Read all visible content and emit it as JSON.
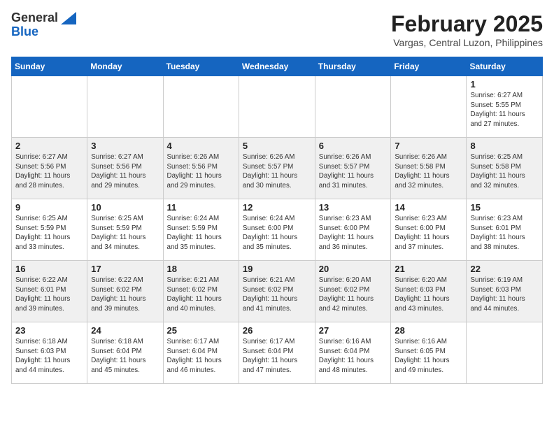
{
  "header": {
    "logo_general": "General",
    "logo_blue": "Blue",
    "month_year": "February 2025",
    "location": "Vargas, Central Luzon, Philippines"
  },
  "weekdays": [
    "Sunday",
    "Monday",
    "Tuesday",
    "Wednesday",
    "Thursday",
    "Friday",
    "Saturday"
  ],
  "weeks": [
    [
      {
        "day": "",
        "info": ""
      },
      {
        "day": "",
        "info": ""
      },
      {
        "day": "",
        "info": ""
      },
      {
        "day": "",
        "info": ""
      },
      {
        "day": "",
        "info": ""
      },
      {
        "day": "",
        "info": ""
      },
      {
        "day": "1",
        "info": "Sunrise: 6:27 AM\nSunset: 5:55 PM\nDaylight: 11 hours\nand 27 minutes."
      }
    ],
    [
      {
        "day": "2",
        "info": "Sunrise: 6:27 AM\nSunset: 5:56 PM\nDaylight: 11 hours\nand 28 minutes."
      },
      {
        "day": "3",
        "info": "Sunrise: 6:27 AM\nSunset: 5:56 PM\nDaylight: 11 hours\nand 29 minutes."
      },
      {
        "day": "4",
        "info": "Sunrise: 6:26 AM\nSunset: 5:56 PM\nDaylight: 11 hours\nand 29 minutes."
      },
      {
        "day": "5",
        "info": "Sunrise: 6:26 AM\nSunset: 5:57 PM\nDaylight: 11 hours\nand 30 minutes."
      },
      {
        "day": "6",
        "info": "Sunrise: 6:26 AM\nSunset: 5:57 PM\nDaylight: 11 hours\nand 31 minutes."
      },
      {
        "day": "7",
        "info": "Sunrise: 6:26 AM\nSunset: 5:58 PM\nDaylight: 11 hours\nand 32 minutes."
      },
      {
        "day": "8",
        "info": "Sunrise: 6:25 AM\nSunset: 5:58 PM\nDaylight: 11 hours\nand 32 minutes."
      }
    ],
    [
      {
        "day": "9",
        "info": "Sunrise: 6:25 AM\nSunset: 5:59 PM\nDaylight: 11 hours\nand 33 minutes."
      },
      {
        "day": "10",
        "info": "Sunrise: 6:25 AM\nSunset: 5:59 PM\nDaylight: 11 hours\nand 34 minutes."
      },
      {
        "day": "11",
        "info": "Sunrise: 6:24 AM\nSunset: 5:59 PM\nDaylight: 11 hours\nand 35 minutes."
      },
      {
        "day": "12",
        "info": "Sunrise: 6:24 AM\nSunset: 6:00 PM\nDaylight: 11 hours\nand 35 minutes."
      },
      {
        "day": "13",
        "info": "Sunrise: 6:23 AM\nSunset: 6:00 PM\nDaylight: 11 hours\nand 36 minutes."
      },
      {
        "day": "14",
        "info": "Sunrise: 6:23 AM\nSunset: 6:00 PM\nDaylight: 11 hours\nand 37 minutes."
      },
      {
        "day": "15",
        "info": "Sunrise: 6:23 AM\nSunset: 6:01 PM\nDaylight: 11 hours\nand 38 minutes."
      }
    ],
    [
      {
        "day": "16",
        "info": "Sunrise: 6:22 AM\nSunset: 6:01 PM\nDaylight: 11 hours\nand 39 minutes."
      },
      {
        "day": "17",
        "info": "Sunrise: 6:22 AM\nSunset: 6:02 PM\nDaylight: 11 hours\nand 39 minutes."
      },
      {
        "day": "18",
        "info": "Sunrise: 6:21 AM\nSunset: 6:02 PM\nDaylight: 11 hours\nand 40 minutes."
      },
      {
        "day": "19",
        "info": "Sunrise: 6:21 AM\nSunset: 6:02 PM\nDaylight: 11 hours\nand 41 minutes."
      },
      {
        "day": "20",
        "info": "Sunrise: 6:20 AM\nSunset: 6:02 PM\nDaylight: 11 hours\nand 42 minutes."
      },
      {
        "day": "21",
        "info": "Sunrise: 6:20 AM\nSunset: 6:03 PM\nDaylight: 11 hours\nand 43 minutes."
      },
      {
        "day": "22",
        "info": "Sunrise: 6:19 AM\nSunset: 6:03 PM\nDaylight: 11 hours\nand 44 minutes."
      }
    ],
    [
      {
        "day": "23",
        "info": "Sunrise: 6:18 AM\nSunset: 6:03 PM\nDaylight: 11 hours\nand 44 minutes."
      },
      {
        "day": "24",
        "info": "Sunrise: 6:18 AM\nSunset: 6:04 PM\nDaylight: 11 hours\nand 45 minutes."
      },
      {
        "day": "25",
        "info": "Sunrise: 6:17 AM\nSunset: 6:04 PM\nDaylight: 11 hours\nand 46 minutes."
      },
      {
        "day": "26",
        "info": "Sunrise: 6:17 AM\nSunset: 6:04 PM\nDaylight: 11 hours\nand 47 minutes."
      },
      {
        "day": "27",
        "info": "Sunrise: 6:16 AM\nSunset: 6:04 PM\nDaylight: 11 hours\nand 48 minutes."
      },
      {
        "day": "28",
        "info": "Sunrise: 6:16 AM\nSunset: 6:05 PM\nDaylight: 11 hours\nand 49 minutes."
      },
      {
        "day": "",
        "info": ""
      }
    ]
  ]
}
